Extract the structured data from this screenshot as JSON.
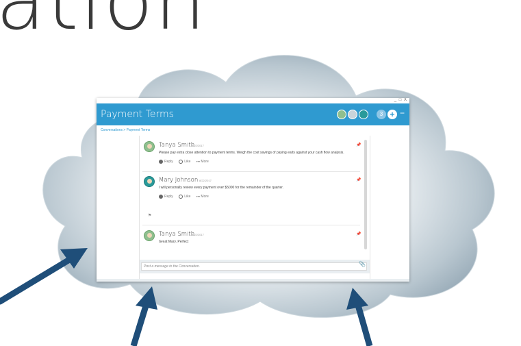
{
  "slide": {
    "title_fragment": "ation"
  },
  "window": {
    "controls": "_ □ X",
    "title": "Payment Terms",
    "participant_count": "3",
    "add_symbol": "+",
    "minimize_symbol": "−",
    "breadcrumb": "Conversations > Payment Terms"
  },
  "posts": [
    {
      "name": "Tanya Smith",
      "date": "8/22/2017",
      "message": "Please pay extra close attention to payment terms.  Weigh the cost savings of paying early against your cash flow analysis.",
      "reply": "Reply",
      "like": "Like",
      "more": "More"
    },
    {
      "name": "Mary Johnson",
      "date": "8/22/2017",
      "message": "I will personally review every payment over $5000 for the remainder of the quarter.",
      "reply": "Reply",
      "like": "Like",
      "more": "More"
    },
    {
      "name": "Tanya Smith",
      "date": "8/22/2017",
      "message": "Great Mary.  Perfect"
    }
  ],
  "compose": {
    "placeholder": "Post a message to the Conversation."
  },
  "colors": {
    "header": "#2f9ad0",
    "arrow": "#1f4e79"
  }
}
